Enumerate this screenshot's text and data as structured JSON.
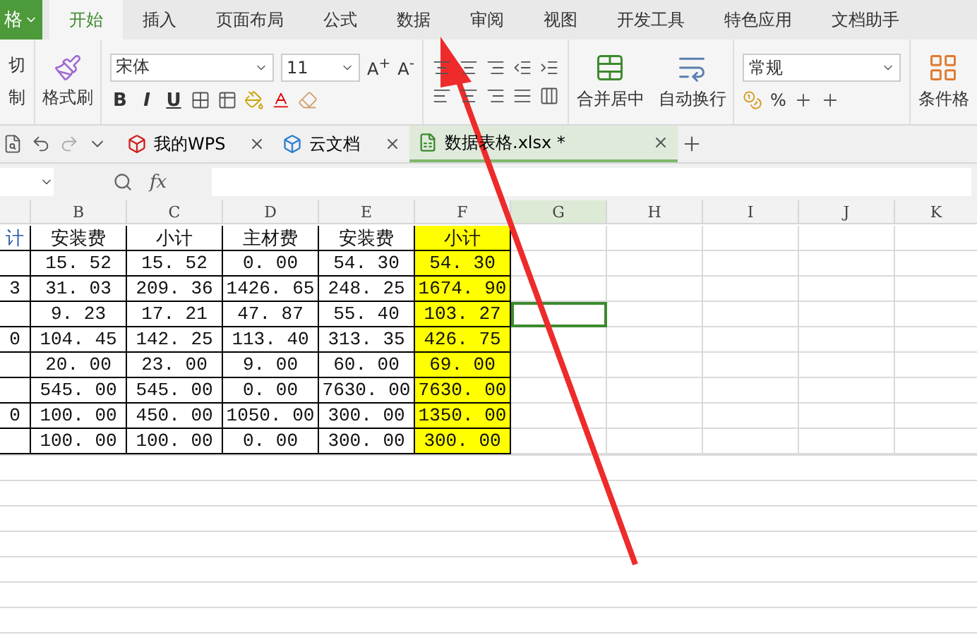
{
  "app_button": {
    "label": "格"
  },
  "ribbon_tabs": [
    {
      "label": "开始",
      "selected": true
    },
    {
      "label": "插入",
      "selected": false
    },
    {
      "label": "页面布局",
      "selected": false
    },
    {
      "label": "公式",
      "selected": false
    },
    {
      "label": "数据",
      "selected": false
    },
    {
      "label": "审阅",
      "selected": false
    },
    {
      "label": "视图",
      "selected": false
    },
    {
      "label": "开发工具",
      "selected": false
    },
    {
      "label": "特色应用",
      "selected": false
    },
    {
      "label": "文档助手",
      "selected": false
    }
  ],
  "ribbon": {
    "cut": "切",
    "copy": "制",
    "format_painter": "格式刷",
    "font_name": "宋体",
    "font_size": "11",
    "grow_font": "A$^{+}$",
    "shrink_font": "A$^{-}$",
    "style_buttons": [
      "B",
      "I",
      "U"
    ],
    "merge": "合并居中",
    "wrap": "自动换行",
    "number_format": "常规",
    "percent": "%",
    "conditional": "条件格"
  },
  "doc_tabs": [
    {
      "label": "我的WPS",
      "selected": false
    },
    {
      "label": "云文档",
      "selected": false
    },
    {
      "label": "数据表格.xlsx *",
      "selected": true
    }
  ],
  "formula_bar": {
    "fx": "fx"
  },
  "sheet": {
    "columns": [
      {
        "label": "B",
        "selected": false
      },
      {
        "label": "C",
        "selected": false
      },
      {
        "label": "D",
        "selected": false
      },
      {
        "label": "E",
        "selected": false
      },
      {
        "label": "F",
        "selected": false,
        "color": "#ffff00"
      },
      {
        "label": "G",
        "selected": true
      },
      {
        "label": "H",
        "selected": false
      },
      {
        "label": "I",
        "selected": false
      },
      {
        "label": "J",
        "selected": false
      },
      {
        "label": "K",
        "selected": false
      }
    ],
    "rows": [
      {
        "a": "计",
        "selected": false,
        "cells": [
          "安装费",
          "小计",
          "主材费",
          "安装费",
          "小计"
        ]
      },
      {
        "selected": false,
        "cells": [
          "15. 52",
          "15. 52",
          "0. 00",
          "54. 30",
          "54. 30"
        ]
      },
      {
        "a": "3",
        "selected": false,
        "cells": [
          "31. 03",
          "209. 36",
          "1426. 65",
          "248. 25",
          "1674. 90"
        ]
      },
      {
        "selected": true,
        "cells": [
          "9. 23",
          "17. 21",
          "47. 87",
          "55. 40",
          "103. 27"
        ]
      },
      {
        "a": "0",
        "selected": false,
        "cells": [
          "104. 45",
          "142. 25",
          "113. 40",
          "313. 35",
          "426. 75"
        ]
      },
      {
        "selected": false,
        "cells": [
          "20. 00",
          "23. 00",
          "9. 00",
          "60. 00",
          "69. 00"
        ]
      },
      {
        "selected": false,
        "cells": [
          "545. 00",
          "545. 00",
          "0. 00",
          "7630. 00",
          "7630. 00"
        ]
      },
      {
        "a": "0",
        "selected": false,
        "cells": [
          "100. 00",
          "450. 00",
          "1050. 00",
          "300. 00",
          "1350. 00"
        ]
      },
      {
        "selected": false,
        "cells": [
          "100. 00",
          "100. 00",
          "0. 00",
          "300. 00",
          "300. 00"
        ]
      }
    ]
  }
}
